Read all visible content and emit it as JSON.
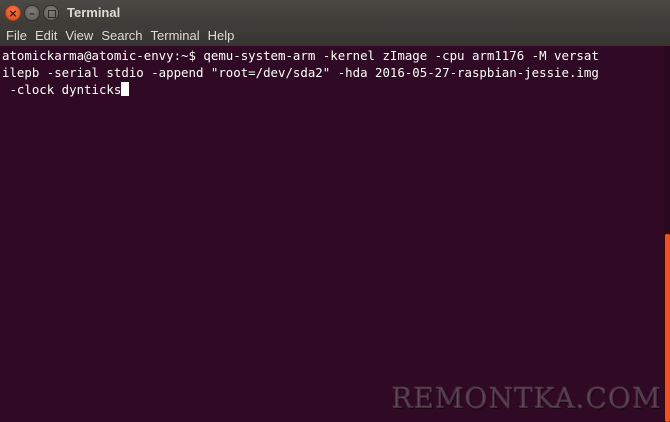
{
  "window": {
    "title": "Terminal",
    "close_glyph": "×",
    "minimize_glyph": "–"
  },
  "menu": {
    "items": [
      "File",
      "Edit",
      "View",
      "Search",
      "Terminal",
      "Help"
    ]
  },
  "terminal": {
    "lines": [
      "atomickarma@atomic-envy:~$ qemu-system-arm -kernel zImage -cpu arm1176 -M versat",
      "ilepb -serial stdio -append \"root=/dev/sda2\" -hda 2016-05-27-raspbian-jessie.img",
      " -clock dynticks"
    ],
    "background": "#300a24",
    "foreground": "#ffffff"
  },
  "scrollbar": {
    "thumb_color": "#e95420"
  },
  "watermark": {
    "text": "REMONTKA.COM"
  },
  "icons": {
    "close": "close-icon",
    "minimize": "minimize-icon",
    "maximize": "maximize-icon"
  }
}
